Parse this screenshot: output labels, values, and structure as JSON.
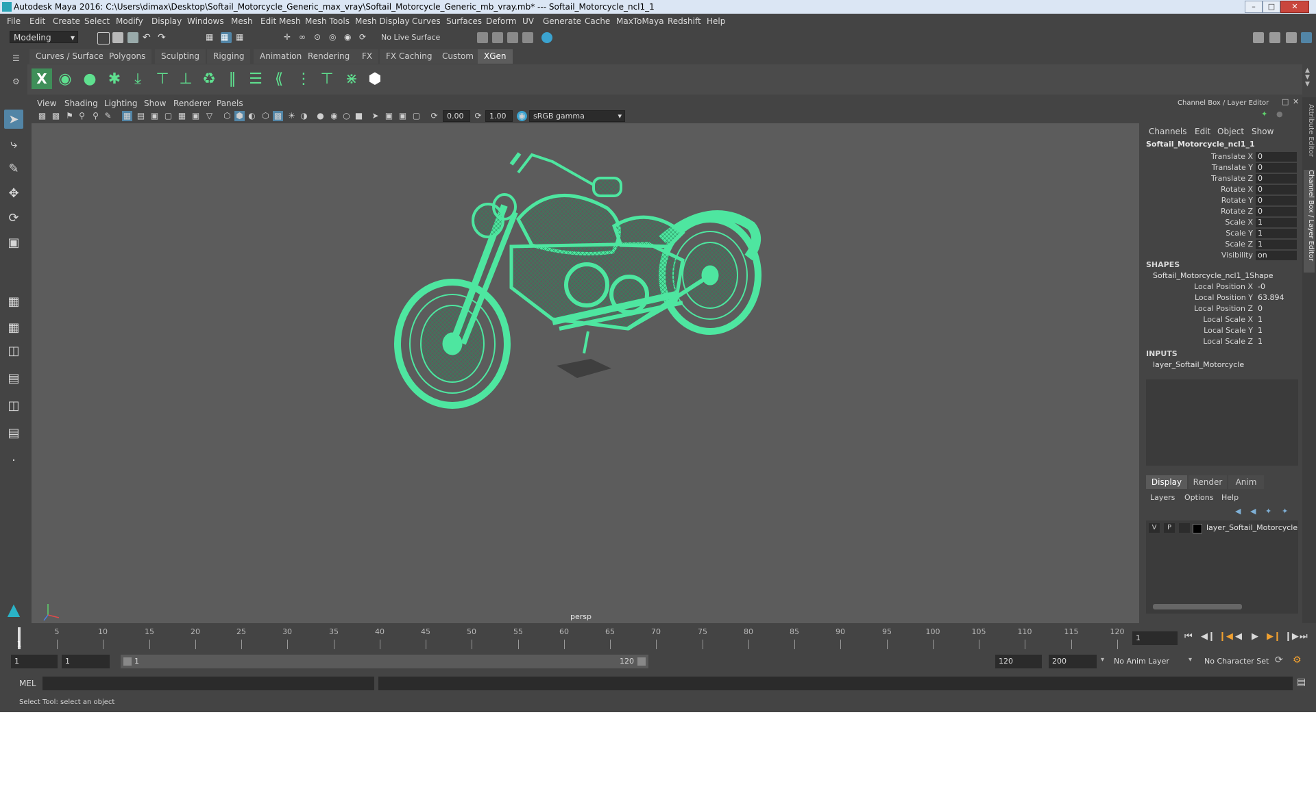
{
  "title": "Autodesk Maya 2016: C:\\Users\\dimax\\Desktop\\Softail_Motorcycle_Generic_max_vray\\Softail_Motorcycle_Generic_mb_vray.mb*   ---   Softail_Motorcycle_ncl1_1",
  "menu": [
    "File",
    "Edit",
    "Create",
    "Select",
    "Modify",
    "Display",
    "Windows",
    "Mesh",
    "Edit Mesh",
    "Mesh Tools",
    "Mesh Display",
    "Curves",
    "Surfaces",
    "Deform",
    "UV",
    "Generate",
    "Cache",
    "MaxToMaya",
    "Redshift",
    "Help"
  ],
  "status": {
    "mode": "Modeling",
    "live_surface": "No Live Surface"
  },
  "shelf_tabs": [
    "Curves / Surfaces",
    "Polygons",
    "Sculpting",
    "Rigging",
    "Animation",
    "Rendering",
    "FX",
    "FX Caching",
    "Custom",
    "XGen"
  ],
  "active_shelf_tab": "XGen",
  "viewport": {
    "menu": [
      "View",
      "Shading",
      "Lighting",
      "Show",
      "Renderer",
      "Panels"
    ],
    "exposure": "0.00",
    "gamma": "1.00",
    "colorspace": "sRGB gamma",
    "camera_label": "persp"
  },
  "channel_box": {
    "header": "Channel Box / Layer Editor",
    "menu": [
      "Channels",
      "Edit",
      "Object",
      "Show"
    ],
    "object": "Softail_Motorcycle_ncl1_1",
    "channels": [
      {
        "name": "Translate X",
        "value": "0"
      },
      {
        "name": "Translate Y",
        "value": "0"
      },
      {
        "name": "Translate Z",
        "value": "0"
      },
      {
        "name": "Rotate X",
        "value": "0"
      },
      {
        "name": "Rotate Y",
        "value": "0"
      },
      {
        "name": "Rotate Z",
        "value": "0"
      },
      {
        "name": "Scale X",
        "value": "1"
      },
      {
        "name": "Scale Y",
        "value": "1"
      },
      {
        "name": "Scale Z",
        "value": "1"
      },
      {
        "name": "Visibility",
        "value": "on"
      }
    ],
    "shapes_label": "SHAPES",
    "shape_name": "Softail_Motorcycle_ncl1_1Shape",
    "shape_channels": [
      {
        "name": "Local Position X",
        "value": "-0"
      },
      {
        "name": "Local Position Y",
        "value": "63.894"
      },
      {
        "name": "Local Position Z",
        "value": "0"
      },
      {
        "name": "Local Scale X",
        "value": "1"
      },
      {
        "name": "Local Scale Y",
        "value": "1"
      },
      {
        "name": "Local Scale Z",
        "value": "1"
      }
    ],
    "inputs_label": "INPUTS",
    "input_name": "layer_Softail_Motorcycle"
  },
  "layer_editor": {
    "tabs": [
      "Display",
      "Render",
      "Anim"
    ],
    "active_tab": "Display",
    "menu": [
      "Layers",
      "Options",
      "Help"
    ],
    "layers": [
      {
        "v": "V",
        "p": "P",
        "name": "layer_Softail_Motorcycle"
      }
    ]
  },
  "side_tabs": {
    "attribute_editor": "Attribute Editor",
    "channel_box": "Channel Box / Layer Editor"
  },
  "timeline": {
    "ticks": [
      "1",
      "5",
      "10",
      "15",
      "20",
      "25",
      "30",
      "35",
      "40",
      "45",
      "50",
      "55",
      "60",
      "65",
      "70",
      "75",
      "80",
      "85",
      "90",
      "95",
      "100",
      "105",
      "110",
      "115",
      "120"
    ],
    "current_frame": "1"
  },
  "range": {
    "start": "1",
    "playback_start": "1",
    "slider_start": "1",
    "slider_end": "120",
    "playback_end": "120",
    "end": "200",
    "anim_layer": "No Anim Layer",
    "character_set": "No Character Set"
  },
  "command": {
    "lang": "MEL"
  },
  "help_text": "Select Tool: select an object",
  "colors": {
    "wireframe": "#4ee6a0",
    "viewport_bg": "#5c5c5c",
    "accent": "#5285a6"
  }
}
